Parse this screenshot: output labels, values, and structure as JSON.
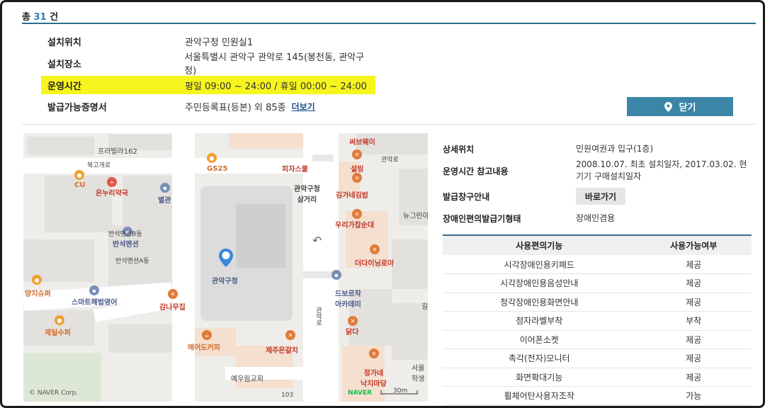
{
  "header": {
    "total_prefix": "총",
    "total_count": "31",
    "total_suffix": "건"
  },
  "info": {
    "location_label": "설치위치",
    "location_value": "관악구청 민원실1",
    "place_label": "설치장소",
    "place_value": "서울특별시 관악구 관악로 145(봉천동, 관악구청)",
    "hours_label": "운영시간",
    "hours_value": "평일 09:00 ~ 24:00 / 휴일 00:00 ~ 24:00",
    "cert_label": "발급가능증명서",
    "cert_value": "주민등록표(등본) 외 85종",
    "more_link": "더보기"
  },
  "close_button": "닫기",
  "map": {
    "labels": {
      "pravilla": "프라빌라162",
      "bukgo": "북고개로",
      "gs25": "GS25",
      "pizzaschool": "피자스쿨",
      "subway": "써브웨이",
      "gwanak_ro": "관악로",
      "seolbing": "설빙",
      "cu": "CU",
      "onnuri": "온누리약국",
      "byeolgwan": "별관",
      "junction": "관악구청\n삼거리",
      "gimga": "김가네김밥",
      "newgreen": "뉴그린아",
      "banseok_b": "반석맨션B동",
      "banseok": "반석맨션",
      "uriga": "우리가찹순대",
      "banseok_a": "반석맨션A동",
      "thedining": "더다이닝로아",
      "gwanak_office": "관악구청",
      "yangji": "양지슈퍼",
      "smart_english": "스마트해법영어",
      "dobo": "드보르작\n아카데미",
      "gamnamu": "감나무집",
      "dakda": "닭다",
      "jeil": "제일수퍼",
      "maeeo": "매어도커피",
      "jeju": "제주은갈치",
      "yewoorim": "예우림교회",
      "jeongga": "정가네\n낙지마당",
      "seoul": "서울\n학생",
      "gwanakro2": "관악로",
      "num103": "103",
      "copyright": "© NAVER Corp.",
      "naver": "NAVER",
      "scale": "30m",
      "gil": "길"
    }
  },
  "details": {
    "detail_loc_label": "상세위치",
    "detail_loc_value": "민원여권과 입구(1층)",
    "hours_note_label": "운영시간 참고내용",
    "hours_note_value": "2008.10.07. 최초 설치일자, 2017.03.02. 현기기 구매설치일자",
    "window_label": "발급창구안내",
    "window_button": "바로가기",
    "disabled_label": "장애인편의발급기형태",
    "disabled_value": "장애인겸용"
  },
  "features_table": {
    "headers": [
      "사용편의기능",
      "사용가능여부"
    ],
    "rows": [
      [
        "시각장애인용키패드",
        "제공"
      ],
      [
        "시각장애인용음성안내",
        "제공"
      ],
      [
        "청각장애인용화면안내",
        "제공"
      ],
      [
        "점자라벨부착",
        "부착"
      ],
      [
        "이어폰소켓",
        "제공"
      ],
      [
        "촉각(전자)모니터",
        "제공"
      ],
      [
        "화면확대기능",
        "제공"
      ],
      [
        "휠체어탄사용자조작",
        "가능"
      ]
    ]
  }
}
